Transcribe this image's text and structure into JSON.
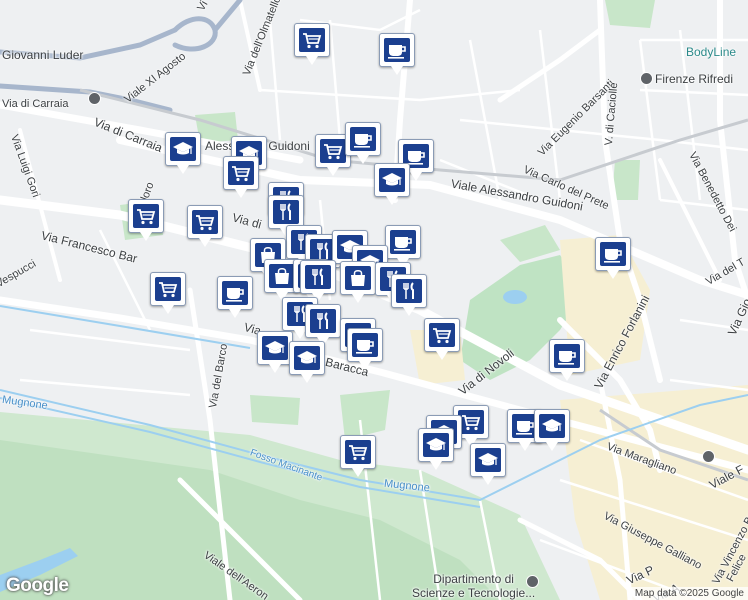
{
  "map": {
    "streets": [
      {
        "id": "viale-xi-agosto",
        "label": "Viale XI Agosto"
      },
      {
        "id": "giovanni-luder",
        "label": "Giovanni Luder"
      },
      {
        "id": "via-dell-olmatello",
        "label": "Via dell'Olmatello"
      },
      {
        "id": "via-di-carraia-1",
        "label": "Via di Carraia"
      },
      {
        "id": "via-di-carraia-2",
        "label": "Via di Carraia"
      },
      {
        "id": "via-luigi-gori",
        "label": "Via Luigi Gori"
      },
      {
        "id": "alessandro-guidoni-1",
        "label": "Alessandro Guidoni"
      },
      {
        "id": "viale-alessandro-guidoni",
        "label": "Viale Alessandro Guidoni"
      },
      {
        "id": "via-francesco-baracca-1",
        "label": "Via Francesco Bar"
      },
      {
        "id": "via-francesco-baracca-2",
        "label": "Baracca"
      },
      {
        "id": "via-di-novoli",
        "label": "Via di Novoli"
      },
      {
        "id": "via-eugenio-barsanti",
        "label": "Via Eugenio Barsanti"
      },
      {
        "id": "via-carlo-del-prete",
        "label": "Via Carlo del Prete"
      },
      {
        "id": "via-di-caciolle",
        "label": "V. di Caciolle"
      },
      {
        "id": "via-benedetto-dei",
        "label": "Via Benedetto Dei"
      },
      {
        "id": "via-enrico-forlanini",
        "label": "Via Enrico Forlanini"
      },
      {
        "id": "via-maragliano",
        "label": "Via Maragliano"
      },
      {
        "id": "via-giuseppe-galliano",
        "label": "Via Giuseppe Galliano"
      },
      {
        "id": "via-vincenzo-bellini",
        "label": "Via Vincenzo Bellini"
      },
      {
        "id": "viale-f",
        "label": "Viale F"
      },
      {
        "id": "via-del-barco",
        "label": "Via del Barco"
      },
      {
        "id": "viale-dell-aeronautica",
        "label": "Viale dell'Aeron"
      },
      {
        "id": "via-alloro",
        "label": "Alloro"
      },
      {
        "id": "via-di-2",
        "label": "Via di"
      },
      {
        "id": "via-3",
        "label": "Via"
      },
      {
        "id": "vespucci",
        "label": "Vespucci"
      },
      {
        "id": "via-de-t",
        "label": "Via del T"
      },
      {
        "id": "via-gio",
        "label": "Via Gio"
      },
      {
        "id": "via-p",
        "label": "Via P"
      },
      {
        "id": "via-a",
        "label": "Via A"
      },
      {
        "id": "felice",
        "label": "Felice"
      },
      {
        "id": "vi",
        "label": "Vi"
      }
    ],
    "waterways": [
      {
        "id": "mugnone-west",
        "label": "Mugnone"
      },
      {
        "id": "mugnone-east",
        "label": "Mugnone"
      },
      {
        "id": "fosso-macinante",
        "label": "Fosso Macinante"
      }
    ],
    "places": [
      {
        "id": "firenze-rifredi",
        "label": "Firenze Rifredi"
      },
      {
        "id": "bodyline",
        "label": "BodyLine"
      },
      {
        "id": "dipartimento",
        "label": "Dipartimento di\nScienze e Tecnologie..."
      }
    ],
    "markers": [
      {
        "type": "grocery",
        "icon": "shopping-cart-icon"
      },
      {
        "type": "cafe",
        "icon": "coffee-cup-icon"
      },
      {
        "type": "education",
        "icon": "graduation-cap-icon"
      },
      {
        "type": "restaurant",
        "icon": "fork-knife-icon"
      },
      {
        "type": "shopping",
        "icon": "shopping-bag-icon"
      }
    ],
    "logo": "Google",
    "attribution": "Map data ©2025 Google"
  }
}
